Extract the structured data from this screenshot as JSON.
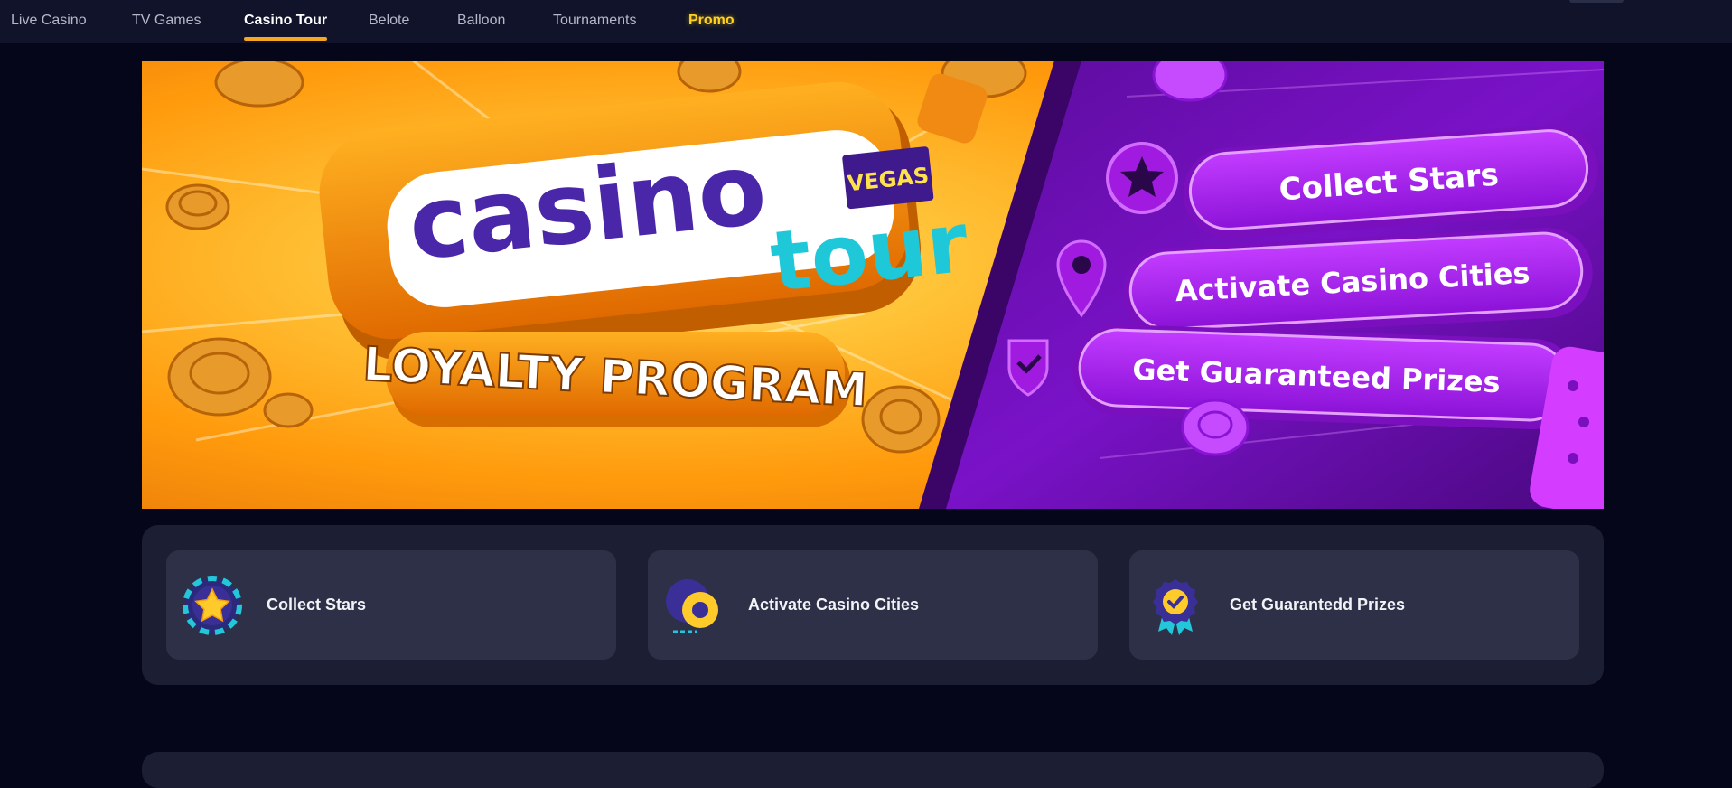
{
  "nav": {
    "items": [
      {
        "label": "Live Casino"
      },
      {
        "label": "TV Games"
      },
      {
        "label": "Casino Tour"
      },
      {
        "label": "Belote"
      },
      {
        "label": "Balloon"
      },
      {
        "label": "Tournaments"
      },
      {
        "label": "Promo"
      }
    ],
    "active_index": 2
  },
  "banner": {
    "logo_word_1": "casino",
    "logo_word_2": "tour",
    "logo_badge": "VEGAS",
    "subtitle": "LOYALTY PROGRAM",
    "pills": [
      "Collect Stars",
      "Activate Casino Cities",
      "Get Guaranteed Prizes"
    ]
  },
  "features": {
    "cards": [
      {
        "label": "Collect Stars",
        "icon": "star-chip-icon"
      },
      {
        "label": "Activate Casino Cities",
        "icon": "map-pin-icon"
      },
      {
        "label": "Get Guarantedd Prizes",
        "icon": "award-ribbon-icon"
      }
    ]
  },
  "colors": {
    "background": "#06061a",
    "nav_bg": "#101329",
    "accent_orange": "#f5a623",
    "promo_yellow": "#ffd21f",
    "panel_bg": "#1c1f33",
    "card_bg": "#2d3046",
    "banner_purple": "#8a14d6",
    "logo_cyan": "#1fc8d8"
  }
}
